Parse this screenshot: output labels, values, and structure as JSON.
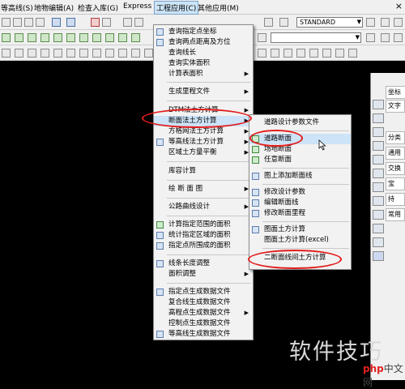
{
  "menubar": {
    "items": [
      "等高线(S)",
      "地物编辑(A)",
      "检查入库(G)",
      "Express",
      "工程应用(C)",
      "其他应用(M)"
    ],
    "close_glyph": "×"
  },
  "toolbar": {
    "combo_value": "STANDARD",
    "combo_arrow": "▼"
  },
  "right_panel": {
    "items": [
      "坐标",
      "文字",
      "分类",
      "通用",
      "交换",
      "宝",
      "持",
      "常用"
    ]
  },
  "main_menu": {
    "items": [
      {
        "label": "查询指定点坐标",
        "icon": "crosshair-icon"
      },
      {
        "label": "查询两点距离及方位",
        "icon": "ruler-icon"
      },
      {
        "label": "查询线长",
        "icon": ""
      },
      {
        "label": "查询实体面积",
        "icon": ""
      },
      {
        "label": "计算表面积",
        "icon": "",
        "submenu": true
      },
      {
        "label": "生成里程文件",
        "icon": "",
        "submenu": true
      },
      {
        "label": "DTM法土方计算",
        "icon": "",
        "submenu": true
      },
      {
        "label": "断面法土方计算",
        "icon": "",
        "submenu": true
      },
      {
        "label": "方格网法土方计算",
        "icon": "",
        "submenu": true
      },
      {
        "label": "等高线法土方计算",
        "icon": "grid-icon",
        "submenu": true
      },
      {
        "label": "区域土方量平衡",
        "icon": "",
        "submenu": true
      },
      {
        "label": "库容计算",
        "icon": ""
      },
      {
        "label": "绘 断 面 图",
        "icon": "",
        "submenu": true
      },
      {
        "label": "公路曲线设计",
        "icon": "",
        "submenu": true
      },
      {
        "label": "计算指定范围的面积",
        "icon": "area-icon"
      },
      {
        "label": "统计指定区域的面积",
        "icon": "area-stats-icon"
      },
      {
        "label": "指定点所围成的面积",
        "icon": "polygon-icon"
      },
      {
        "label": "线条长度调整",
        "icon": "line-length-icon"
      },
      {
        "label": "面积调整",
        "icon": "",
        "submenu": true
      },
      {
        "label": "指定点生成数据文件",
        "icon": "point-file-icon"
      },
      {
        "label": "复合线生成数据文件",
        "icon": ""
      },
      {
        "label": "高程点生成数据文件",
        "icon": "",
        "submenu": true
      },
      {
        "label": "控制点生成数据文件",
        "icon": ""
      },
      {
        "label": "等高线生成数据文件",
        "icon": "contour-file-icon"
      }
    ],
    "submenu_arrow": "▶"
  },
  "sub_menu": {
    "items": [
      {
        "label": "道路设计参数文件",
        "icon": ""
      },
      {
        "label": "道路断面",
        "icon": "road-section-icon"
      },
      {
        "label": "场地断面",
        "icon": "site-section-icon"
      },
      {
        "label": "任意断面",
        "icon": "any-section-icon"
      },
      {
        "label": "图上添加断面线",
        "icon": "add-section-line-icon"
      },
      {
        "label": "修改设计参数",
        "icon": "edit-param-icon"
      },
      {
        "label": "编辑断面线",
        "icon": "edit-line-icon"
      },
      {
        "label": "修改断面里程",
        "icon": "edit-mileage-icon"
      },
      {
        "label": "图面土方计算",
        "icon": "earthwork-icon"
      },
      {
        "label": "图面土方计算(excel)",
        "icon": ""
      },
      {
        "label": "二断面线间土方计算",
        "icon": ""
      }
    ]
  },
  "watermark": {
    "text": "软件技巧",
    "logo_red": "php",
    "logo_dark": "中文网"
  },
  "colors": {
    "highlight_ring": "#e21c1c",
    "menu_highlight": "#cde3f7",
    "canvas": "#000000"
  }
}
